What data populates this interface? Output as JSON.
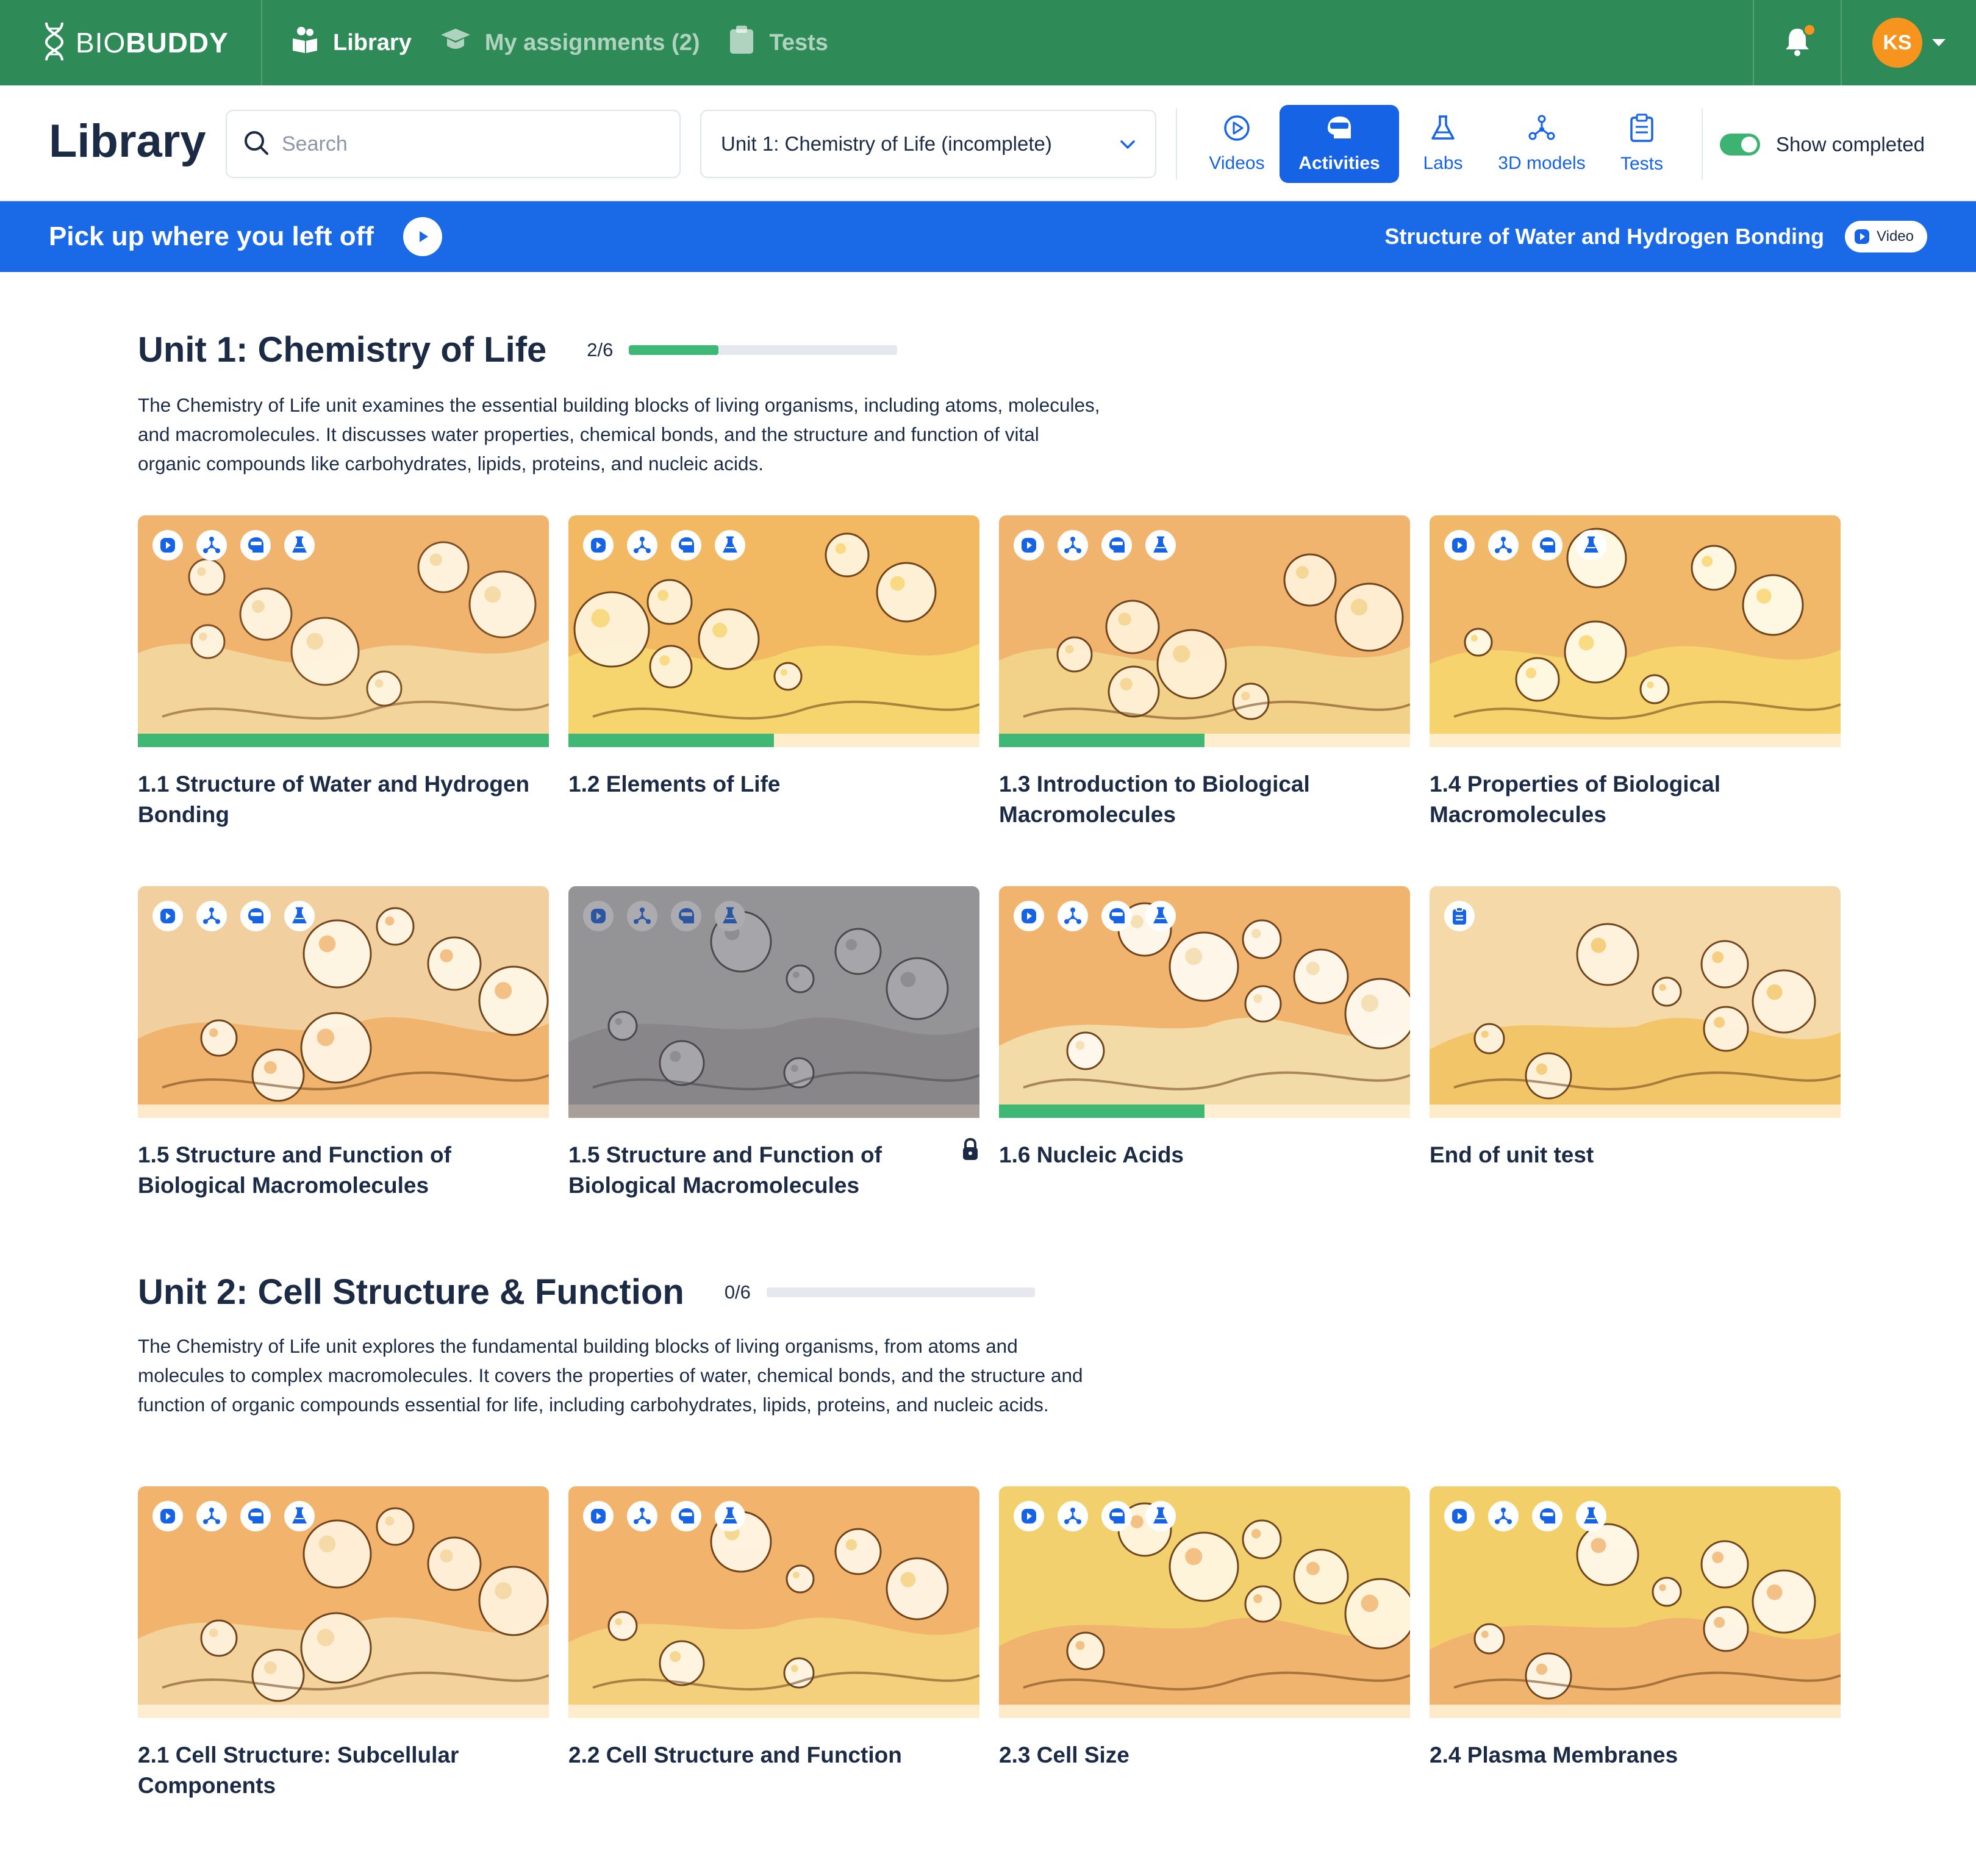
{
  "brand": {
    "name_light": "BIO",
    "name_bold": "BUDDY"
  },
  "nav": {
    "library": "Library",
    "assignments": "My assignments (2)",
    "tests": "Tests",
    "avatar_initials": "KS"
  },
  "toolbar": {
    "title": "Library",
    "search_placeholder": "Search",
    "unit_selected": "Unit 1: Chemistry of Life (incomplete)",
    "filters": {
      "videos": "Videos",
      "activities": "Activities",
      "labs": "Labs",
      "models": "3D models",
      "tests": "Tests"
    },
    "active_filter": "activities",
    "show_completed_label": "Show completed",
    "show_completed": true
  },
  "banner": {
    "title": "Pick up where you left off",
    "lesson": "Structure of Water and Hydrogen Bonding",
    "badge": "Video"
  },
  "colors": {
    "nav_green": "#2e8b57",
    "accent_blue": "#1663e6",
    "progress_green": "#3fb876",
    "avatar_orange": "#f7941d"
  },
  "units": [
    {
      "title": "Unit 1: Chemistry of Life",
      "count": "2/6",
      "progress": 0.333,
      "description": "The Chemistry of Life unit examines the essential building blocks of living organisms, including atoms, molecules, and macromolecules. It discusses water properties, chemical bonds, and the structure and function of vital organic compounds like carbohydrates, lipids, proteins, and nucleic acids.",
      "cards": [
        {
          "title": "1.1 Structure of Water and Hydrogen Bonding",
          "progress": 1.0,
          "icons": [
            "video-icon",
            "model-icon",
            "activity-icon",
            "lab-icon"
          ]
        },
        {
          "title": "1.2 Elements of Life",
          "progress": 0.5,
          "icons": [
            "video-icon",
            "model-icon",
            "activity-icon",
            "lab-icon"
          ]
        },
        {
          "title": "1.3 Introduction to Biological Macromolecules",
          "progress": 0.5,
          "icons": [
            "video-icon",
            "model-icon",
            "activity-icon",
            "lab-icon"
          ]
        },
        {
          "title": "1.4 Properties of Biological Macromolecules",
          "progress": 0,
          "icons": [
            "video-icon",
            "model-icon",
            "activity-icon",
            "lab-icon"
          ]
        },
        {
          "title": "1.5 Structure and Function of Biological Macromolecules",
          "progress": 0,
          "icons": [
            "video-icon",
            "model-icon",
            "activity-icon",
            "lab-icon"
          ]
        },
        {
          "title": "1.5 Structure and Function of Biological Macromolecules",
          "progress": 0,
          "locked": true,
          "icons": [
            "video-icon",
            "model-icon",
            "activity-icon",
            "lab-icon"
          ]
        },
        {
          "title": "1.6 Nucleic Acids",
          "progress": 0.5,
          "icons": [
            "video-icon",
            "model-icon",
            "activity-icon",
            "lab-icon"
          ]
        },
        {
          "title": "End of unit test",
          "progress": 0,
          "icons": [
            "test-icon"
          ]
        }
      ]
    },
    {
      "title": "Unit 2: Cell Structure & Function",
      "count": "0/6",
      "progress": 0,
      "description": "The Chemistry of Life unit explores the fundamental building blocks of living organisms, from atoms and molecules to complex macromolecules. It covers the properties of water, chemical bonds, and the structure and function of organic compounds essential for life, including carbohydrates, lipids, proteins, and nucleic acids.",
      "cards": [
        {
          "title": "2.1 Cell Structure: Subcellular Components",
          "progress": 0,
          "icons": [
            "video-icon",
            "model-icon",
            "activity-icon",
            "lab-icon"
          ]
        },
        {
          "title": "2.2 Cell Structure and Function",
          "progress": 0,
          "icons": [
            "video-icon",
            "model-icon",
            "activity-icon",
            "lab-icon"
          ]
        },
        {
          "title": "2.3 Cell Size",
          "progress": 0,
          "icons": [
            "video-icon",
            "model-icon",
            "activity-icon",
            "lab-icon"
          ]
        },
        {
          "title": "2.4 Plasma Membranes",
          "progress": 0,
          "icons": [
            "video-icon",
            "model-icon",
            "activity-icon",
            "lab-icon"
          ]
        }
      ]
    }
  ]
}
